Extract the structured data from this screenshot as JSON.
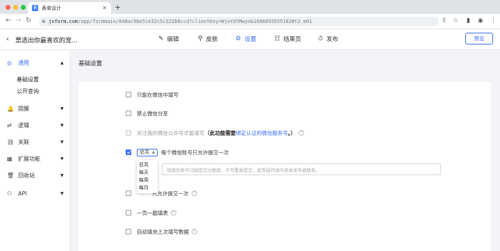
{
  "browser": {
    "tab_title": "表单设计",
    "tab_favicon": "表",
    "url_host": "jsform.com",
    "url_path": "/app/formmain/648ac9be5ce32c5c222b6ccd?clientKey=WjoYdYMwyn&1686893555182#t2_m01"
  },
  "header": {
    "back_icon": "chevron-left-icon",
    "form_title": "票选出你最喜欢的宠...",
    "tabs": [
      {
        "icon": "✎",
        "label": "编辑"
      },
      {
        "icon": "⚲",
        "label": "皮肤"
      },
      {
        "icon": "⚙",
        "label": "设置"
      },
      {
        "icon": "☷",
        "label": "结果页"
      },
      {
        "icon": "⏱",
        "label": "发布"
      }
    ],
    "active_tab": "设置",
    "preview_label": "预览",
    "accent": "#3b6ef0"
  },
  "sidebar": {
    "groups": [
      {
        "icon": "◎",
        "label": "通用",
        "expanded": true,
        "subs": [
          "基础设置",
          "公开查询"
        ]
      },
      {
        "icon": "🔔",
        "label": "提醒"
      },
      {
        "icon": "⇄",
        "label": "逻辑"
      },
      {
        "icon": "⛓",
        "label": "关联"
      },
      {
        "icon": "▦",
        "label": "扩展功能"
      },
      {
        "icon": "🗑",
        "label": "回收站"
      },
      {
        "icon": "⚇",
        "label": "API"
      }
    ]
  },
  "main": {
    "title": "基础设置",
    "options": [
      {
        "label": "只能在微信中填写",
        "checked": false
      },
      {
        "label": "禁止微信分享",
        "checked": false
      },
      {
        "label": "关注我的微信公众号才能填写",
        "note_prefix": "（此功能需要",
        "note_link": "绑定认证的微信服务号",
        "note_suffix": "。）",
        "disabled": true
      },
      {
        "label": "每个微信账号只允许提交一次",
        "checked": true,
        "select_value": "总共"
      },
      {
        "label": "只允许提交一次",
        "checked": false
      },
      {
        "label": "一页一题填表",
        "checked": false
      },
      {
        "label": "自动填充上次填写数据",
        "checked": false
      }
    ],
    "frequency_options": [
      "总共",
      "每天",
      "每周",
      "每月"
    ],
    "message_placeholder": "该微信账号已经提交过数据，不可重复提交，如有疑问请与表单发布者联系。"
  }
}
